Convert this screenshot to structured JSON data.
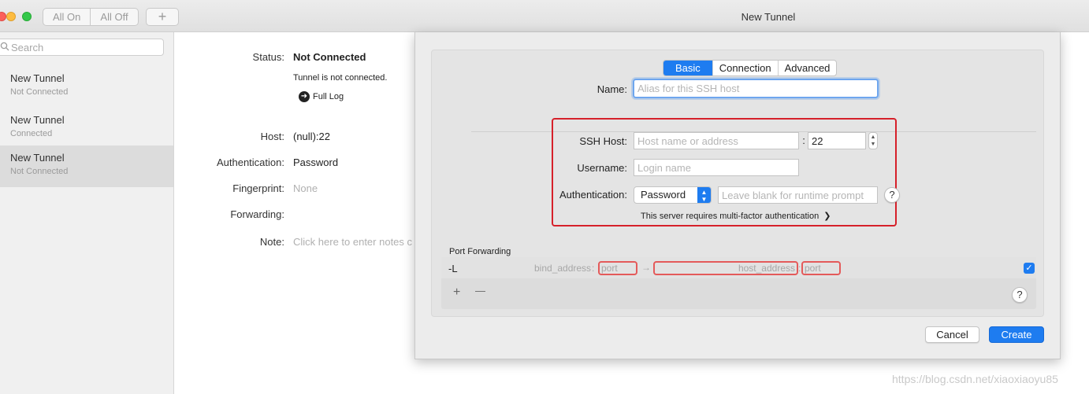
{
  "toolbar": {
    "all_on_label": "All On",
    "all_off_label": "All Off",
    "add_label": "+"
  },
  "window": {
    "title": "New Tunnel"
  },
  "sidebar": {
    "search_placeholder": "Search",
    "items": [
      {
        "name": "New Tunnel",
        "status": "Not Connected"
      },
      {
        "name": "New Tunnel",
        "status": "Connected"
      },
      {
        "name": "New Tunnel",
        "status": "Not Connected"
      }
    ]
  },
  "detail": {
    "status_label": "Status:",
    "status_value": "Not Connected",
    "status_message": "Tunnel is not connected.",
    "full_log_label": "Full Log",
    "host_label": "Host:",
    "host_value": "(null):22",
    "auth_label": "Authentication:",
    "auth_value": "Password",
    "fingerprint_label": "Fingerprint:",
    "fingerprint_value": "None",
    "forwarding_label": "Forwarding:",
    "note_label": "Note:",
    "note_placeholder": "Click here to enter notes c"
  },
  "sheet": {
    "tabs": [
      "Basic",
      "Connection",
      "Advanced"
    ],
    "name_label": "Name:",
    "name_placeholder": "Alias for this SSH host",
    "ssh_host_label": "SSH Host:",
    "ssh_host_placeholder": "Host name or address",
    "port_separator": ":",
    "port_value": "22",
    "username_label": "Username:",
    "username_placeholder": "Login name",
    "auth_label": "Authentication:",
    "auth_selected": "Password",
    "auth_prompt_placeholder": "Leave blank for runtime prompt",
    "help_label": "?",
    "mfa_text": "This server requires multi-factor authentication",
    "mfa_chevron": "❯",
    "port_forwarding_title": "Port Forwarding",
    "forward": {
      "type": "-L",
      "bind_address_placeholder": "bind_address",
      "bind_separator": ":",
      "bind_port_placeholder": "port",
      "arrow": "→",
      "host_address_placeholder": "host_address",
      "host_separator": ":",
      "host_port_placeholder": "port",
      "checked_mark": "✓"
    },
    "add_label": "+",
    "remove_label": "—",
    "cancel_label": "Cancel",
    "create_label": "Create"
  },
  "watermark": "https://blog.csdn.net/xiaoxiaoyu85",
  "colors": {
    "accent": "#1e7cf0",
    "highlight": "#d6202a"
  }
}
